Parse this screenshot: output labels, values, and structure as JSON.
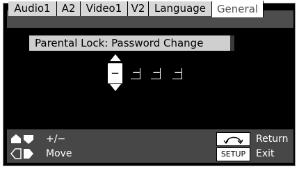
{
  "tabs": [
    {
      "label": "Audio1"
    },
    {
      "label": "A2"
    },
    {
      "label": "Video1"
    },
    {
      "label": "V2"
    },
    {
      "label": "Language"
    },
    {
      "label": "General"
    }
  ],
  "selected_tab": "General",
  "title": "Parental Lock: Password Change",
  "password": {
    "active_char": "−",
    "slots": [
      "−",
      "−",
      "−"
    ]
  },
  "footer": {
    "adjust_label": "+/−",
    "move_label": "Move",
    "return_label": "Return",
    "exit_label": "Exit",
    "setup_key": "SETUP"
  },
  "colors": {
    "background": "#000000",
    "tab_bg": "#d7d7d7",
    "tab_selected_bg": "#ffffff",
    "footer_bg": "#474747",
    "title_bg": "#cfcfcf"
  }
}
